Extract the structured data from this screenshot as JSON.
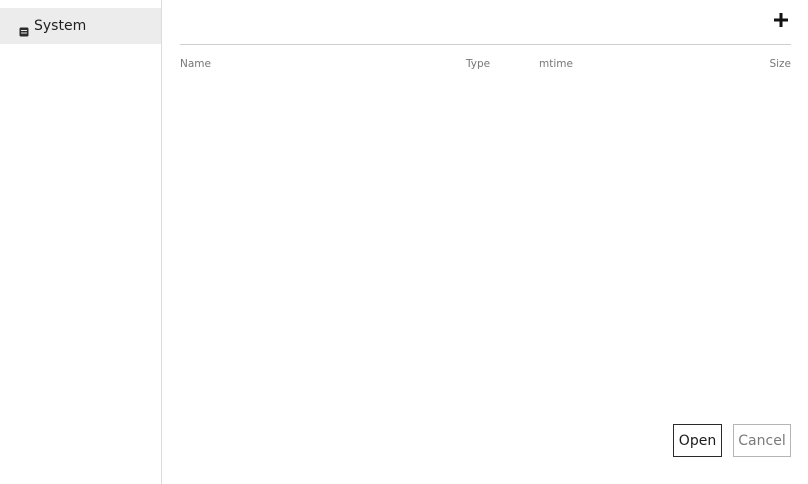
{
  "sidebar": {
    "items": [
      {
        "label": "System",
        "icon": "drive-icon",
        "selected": true
      }
    ]
  },
  "toolbar": {
    "add_icon": "plus-icon"
  },
  "file_list": {
    "columns": [
      "Name",
      "Type",
      "mtime",
      "Size"
    ],
    "rows": []
  },
  "actions": {
    "open_label": "Open",
    "cancel_label": "Cancel"
  },
  "colors": {
    "selected_bg": "#ececec",
    "border": "#dcdcdc",
    "header_text": "#777777",
    "disabled_text": "#7a7a7a"
  }
}
